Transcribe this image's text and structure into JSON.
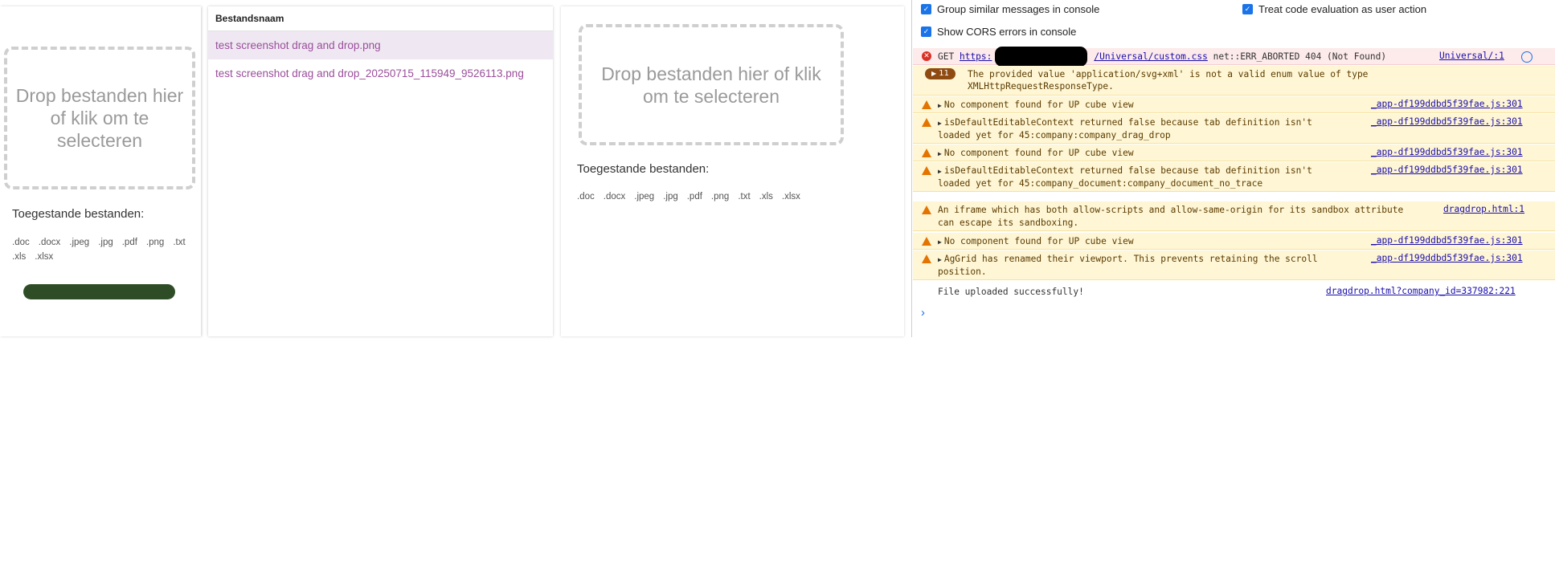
{
  "uploader_left": {
    "drop_text": "Drop bestanden hier of klik om te selecteren",
    "allowed_label": "Toegestande bestanden:",
    "extensions": [
      ".doc",
      ".docx",
      ".jpeg",
      ".jpg",
      ".pdf",
      ".png",
      ".txt",
      ".xls",
      ".xlsx"
    ],
    "progress": 1.0
  },
  "file_list": {
    "header": "Bestandsnaam",
    "rows": [
      {
        "name": "test screenshot drag and drop.png",
        "selected": true
      },
      {
        "name": "test screenshot drag and drop_20250715_115949_9526113.png",
        "selected": false
      }
    ]
  },
  "uploader_right": {
    "drop_text": "Drop bestanden hier of klik om te selecteren",
    "allowed_label": "Toegestande bestanden:",
    "extensions": [
      ".doc",
      ".docx",
      ".jpeg",
      ".jpg",
      ".pdf",
      ".png",
      ".txt",
      ".xls",
      ".xlsx"
    ]
  },
  "console": {
    "options": {
      "group_similar": "Group similar messages in console",
      "treat_code_eval": "Treat code evaluation as user action",
      "show_cors": "Show CORS errors in console"
    },
    "messages": [
      {
        "level": "error",
        "prefix": "GET",
        "url_start": "https:",
        "url_end": "/Universal/custom.css",
        "text": "net::ERR_ABORTED 404 (Not Found)",
        "source": "Universal/:1"
      },
      {
        "level": "warn-count",
        "count": "11",
        "line1": "The provided value 'application/svg+xml' is not a valid enum value of type",
        "line2": "XMLHttpRequestResponseType."
      },
      {
        "level": "warn",
        "line1": "No component found for UP cube view",
        "source": "_app-df199ddbd5f39fae.js:301"
      },
      {
        "level": "warn",
        "line1": "isDefaultEditableContext returned false because tab definition isn't",
        "line2": "loaded yet for 45:company:company_drag_drop",
        "source": "_app-df199ddbd5f39fae.js:301"
      },
      {
        "level": "warn",
        "line1": "No component found for UP cube view",
        "source": "_app-df199ddbd5f39fae.js:301"
      },
      {
        "level": "warn",
        "line1": "isDefaultEditableContext returned false because tab definition isn't",
        "line2": "loaded yet for 45:company_document:company_document_no_trace",
        "source": "_app-df199ddbd5f39fae.js:301"
      },
      {
        "level": "warn",
        "line1": "An iframe which has both allow-scripts and allow-same-origin for its sandbox attribute",
        "line2": "can escape its sandboxing.",
        "source": "dragdrop.html:1"
      },
      {
        "level": "warn",
        "line1": "No component found for UP cube view",
        "source": "_app-df199ddbd5f39fae.js:301"
      },
      {
        "level": "warn",
        "line1": "AgGrid has renamed their viewport. This prevents retaining the scroll",
        "line2": "position.",
        "source": "_app-df199ddbd5f39fae.js:301"
      },
      {
        "level": "log",
        "line1": "File uploaded successfully!",
        "source": "dragdrop.html?company_id=337982:221"
      }
    ]
  },
  "colors": {
    "progress": "#2e4d27",
    "file_link": "#9a4e9a",
    "selected_row": "#efe8f2",
    "warn_bg": "#fef6d5",
    "error_bg": "#fdeaea"
  }
}
